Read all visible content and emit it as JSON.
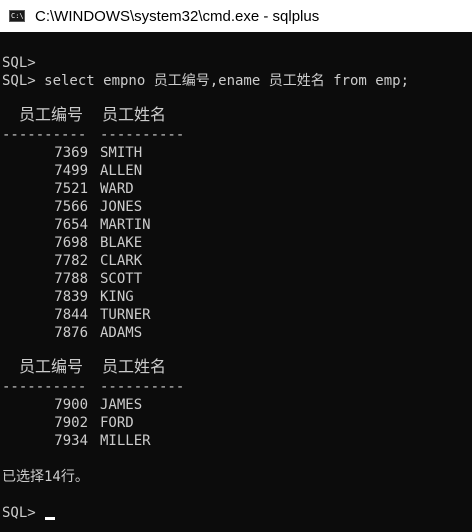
{
  "window": {
    "title": "C:\\WINDOWS\\system32\\cmd.exe - sqlplus",
    "icon": "cmd-console-icon"
  },
  "console": {
    "prompt_empty": "SQL>",
    "command_line": "SQL> select empno 员工编号,ename 员工姓名 from emp;",
    "headers": [
      "员工编号",
      "员工姓名"
    ],
    "dash_empno": "----------",
    "dash_ename": "----------",
    "page1": [
      {
        "empno": "7369",
        "ename": "SMITH"
      },
      {
        "empno": "7499",
        "ename": "ALLEN"
      },
      {
        "empno": "7521",
        "ename": "WARD"
      },
      {
        "empno": "7566",
        "ename": "JONES"
      },
      {
        "empno": "7654",
        "ename": "MARTIN"
      },
      {
        "empno": "7698",
        "ename": "BLAKE"
      },
      {
        "empno": "7782",
        "ename": "CLARK"
      },
      {
        "empno": "7788",
        "ename": "SCOTT"
      },
      {
        "empno": "7839",
        "ename": "KING"
      },
      {
        "empno": "7844",
        "ename": "TURNER"
      },
      {
        "empno": "7876",
        "ename": "ADAMS"
      }
    ],
    "page2": [
      {
        "empno": "7900",
        "ename": "JAMES"
      },
      {
        "empno": "7902",
        "ename": "FORD"
      },
      {
        "empno": "7934",
        "ename": "MILLER"
      }
    ],
    "result_message": "已选择14行。",
    "final_prompt": "SQL>"
  },
  "colors": {
    "console_background": "#0c0c0c",
    "console_text": "#cccccc",
    "titlebar_background": "#ffffff"
  }
}
